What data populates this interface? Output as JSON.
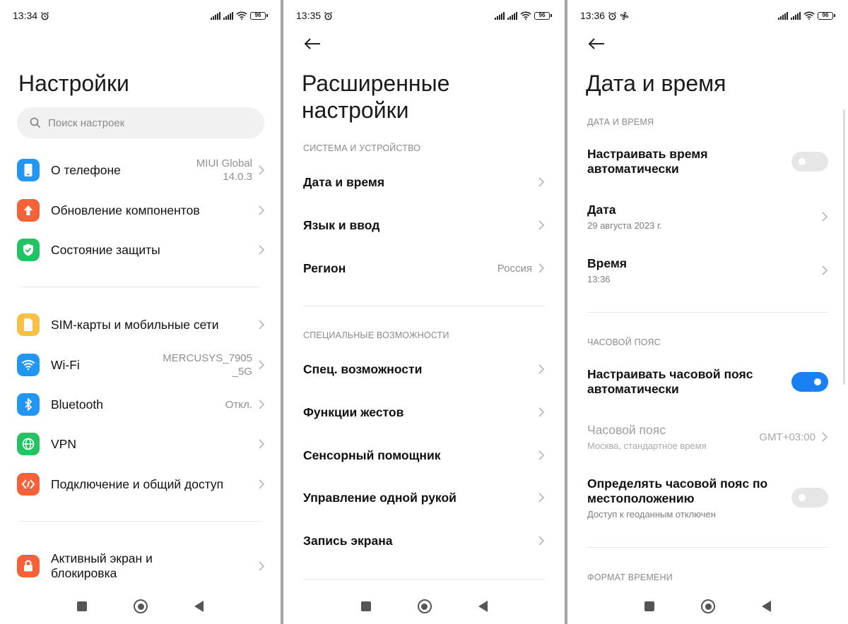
{
  "colors": {
    "accent": "#1a80f4",
    "icon_phone": "#2196f3",
    "icon_update": "#f4623a",
    "icon_security": "#25c264",
    "icon_sim": "#f7c046",
    "icon_wifi": "#2196f3",
    "icon_bluetooth": "#2196f3",
    "icon_vpn": "#25c264",
    "icon_connection": "#f4623a",
    "icon_lock": "#f4623a"
  },
  "screen1": {
    "status_time": "13:34",
    "battery": "96",
    "title": "Настройки",
    "search_placeholder": "Поиск настроек",
    "items": [
      {
        "label": "О телефоне",
        "value": "MIUI Global\n14.0.3",
        "icon": "phone-icon"
      },
      {
        "label": "Обновление компонентов",
        "value": "",
        "icon": "update-arrow-icon"
      },
      {
        "label": "Состояние защиты",
        "value": "",
        "icon": "shield-check-icon"
      },
      {
        "label": "SIM-карты и мобильные сети",
        "value": "",
        "icon": "sim-card-icon"
      },
      {
        "label": "Wi-Fi",
        "value": "MERCUSYS_7905\n_5G",
        "icon": "wifi-icon"
      },
      {
        "label": "Bluetooth",
        "value": "Откл.",
        "icon": "bluetooth-icon"
      },
      {
        "label": "VPN",
        "value": "",
        "icon": "globe-icon"
      },
      {
        "label": "Подключение и общий доступ",
        "value": "",
        "icon": "connection-icon"
      },
      {
        "label": "Активный экран и\nблокировка",
        "value": "",
        "icon": "lock-icon"
      }
    ]
  },
  "screen2": {
    "status_time": "13:35",
    "battery": "96",
    "title": "Расширенные\nнастройки",
    "section1": "СИСТЕМА И УСТРОЙСТВО",
    "section2": "СПЕЦИАЛЬНЫЕ ВОЗМОЖНОСТИ",
    "rows1": [
      {
        "label": "Дата и время",
        "value": ""
      },
      {
        "label": "Язык и ввод",
        "value": ""
      },
      {
        "label": "Регион",
        "value": "Россия"
      }
    ],
    "rows2": [
      {
        "label": "Спец. возможности"
      },
      {
        "label": "Функции жестов"
      },
      {
        "label": "Сенсорный помощник"
      },
      {
        "label": "Управление одной рукой"
      },
      {
        "label": "Запись экрана"
      }
    ]
  },
  "screen3": {
    "status_time": "13:36",
    "battery": "96",
    "title": "Дата и время",
    "section1": "ДАТА И ВРЕМЯ",
    "auto_time_label": "Настраивать время\nавтоматически",
    "auto_time_on": false,
    "date_label": "Дата",
    "date_value": "29 августа 2023 г.",
    "time_label": "Время",
    "time_value": "13:36",
    "section2": "ЧАСОВОЙ ПОЯС",
    "auto_tz_label": "Настраивать часовой пояс\nавтоматически",
    "auto_tz_on": true,
    "tz_label": "Часовой пояс",
    "tz_sub": "Москва, стандартное время",
    "tz_value": "GMT+03:00",
    "geo_tz_label": "Определять часовой пояс по\nместоположению",
    "geo_tz_sub": "Доступ к геоданным отключен",
    "geo_tz_on": false,
    "section3": "ФОРМАТ ВРЕМЕНИ"
  }
}
